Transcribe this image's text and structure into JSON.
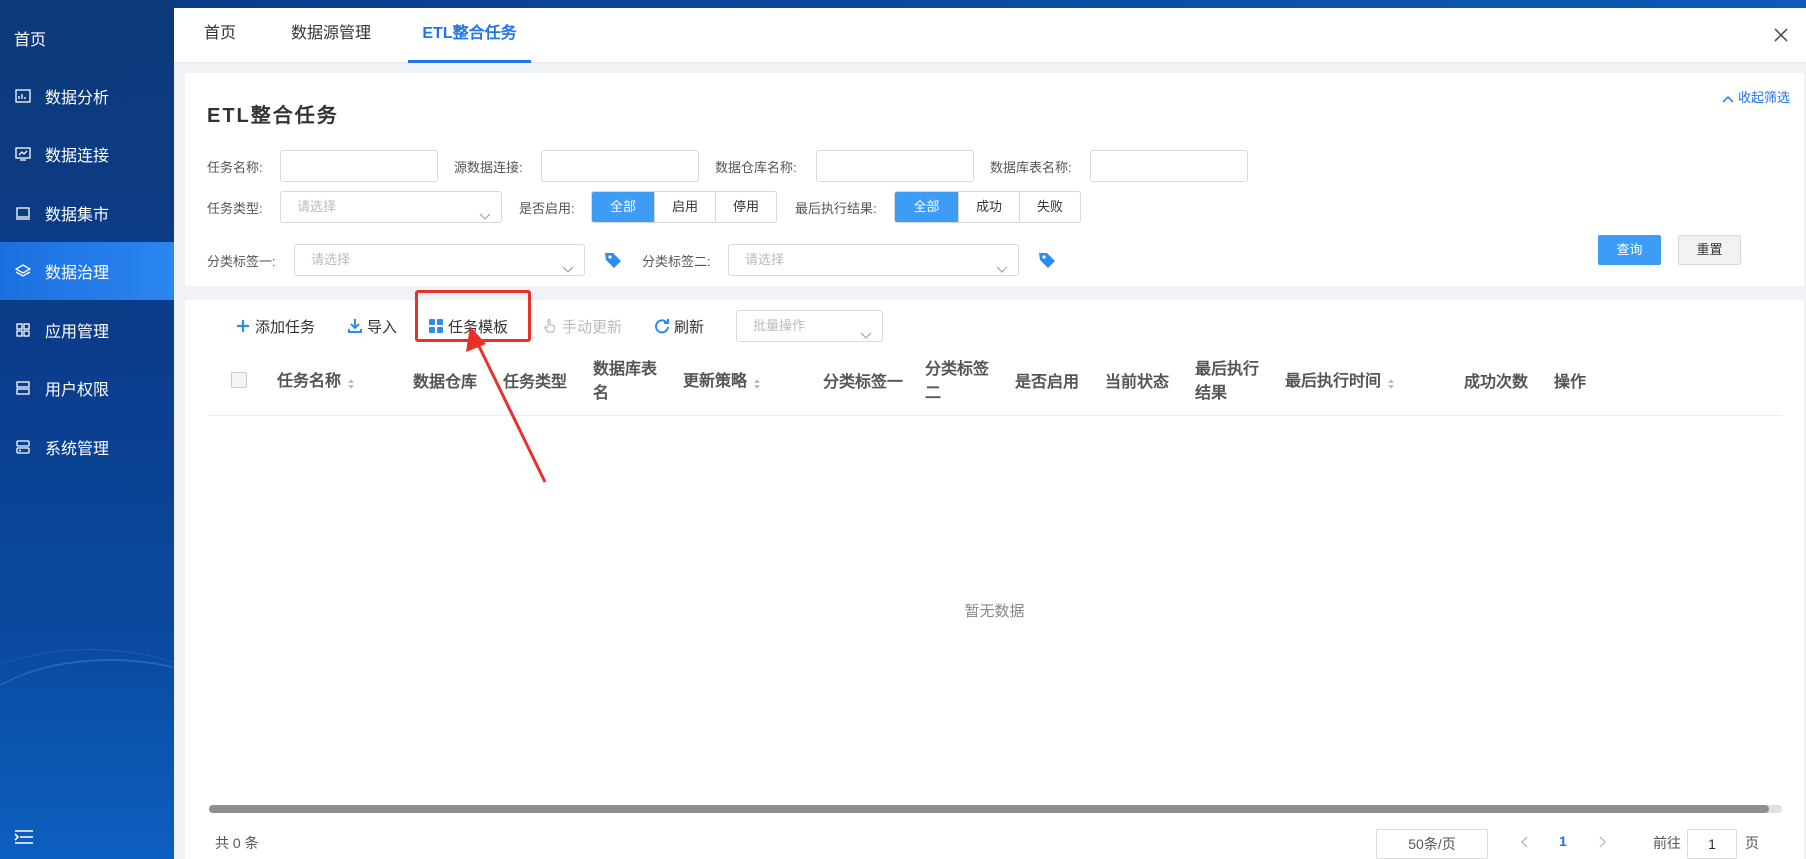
{
  "sidebar": {
    "home": "首页",
    "items": [
      {
        "label": "数据分析",
        "icon": "chart-icon"
      },
      {
        "label": "数据连接",
        "icon": "monitor-link-icon"
      },
      {
        "label": "数据集市",
        "icon": "laptop-icon"
      },
      {
        "label": "数据治理",
        "icon": "layers-icon",
        "active": true
      },
      {
        "label": "应用管理",
        "icon": "grid-icon"
      },
      {
        "label": "用户权限",
        "icon": "server-icon"
      },
      {
        "label": "系统管理",
        "icon": "settings-panel-icon"
      }
    ]
  },
  "tabs": [
    {
      "label": "首页"
    },
    {
      "label": "数据源管理"
    },
    {
      "label": "ETL整合任务",
      "active": true
    }
  ],
  "filter": {
    "title": "ETL整合任务",
    "collapse_label": "收起筛选",
    "task_name_label": "任务名称:",
    "source_conn_label": "源数据连接:",
    "warehouse_name_label": "数据仓库名称:",
    "table_name_label": "数据库表名称:",
    "task_type_label": "任务类型:",
    "task_type_placeholder": "请选择",
    "enabled_label": "是否启用:",
    "enabled_options": [
      "全部",
      "启用",
      "停用"
    ],
    "last_result_label": "最后执行结果:",
    "last_result_options": [
      "全部",
      "成功",
      "失败"
    ],
    "tag1_label": "分类标签一:",
    "tag1_placeholder": "请选择",
    "tag2_label": "分类标签二:",
    "tag2_placeholder": "请选择",
    "query_label": "查询",
    "reset_label": "重置"
  },
  "toolbar": {
    "add_task": "添加任务",
    "import": "导入",
    "template": "任务模板",
    "manual_update": "手动更新",
    "refresh": "刷新",
    "batch_placeholder": "批量操作"
  },
  "table": {
    "columns": [
      {
        "label": "任务名称"
      },
      {
        "label": "数据仓库"
      },
      {
        "label": "任务类型"
      },
      {
        "label": "数据库表\n名"
      },
      {
        "label": "更新策略"
      },
      {
        "label": "分类标签一"
      },
      {
        "label": "分类标签\n二"
      },
      {
        "label": "是否启用"
      },
      {
        "label": "当前状态"
      },
      {
        "label": "最后执行\n结果"
      },
      {
        "label": "最后执行时间"
      },
      {
        "label": "成功次数"
      },
      {
        "label": "操作"
      }
    ],
    "empty_text": "暂无数据"
  },
  "pagination": {
    "total": "共 0 条",
    "page_size": "50条/页",
    "current_page": "1",
    "goto_label": "前往",
    "goto_value": "1",
    "page_word": "页"
  },
  "colors": {
    "accent": "#1f74ec",
    "segment_active": "#3d9cf5",
    "highlight_box": "#e8312a"
  }
}
